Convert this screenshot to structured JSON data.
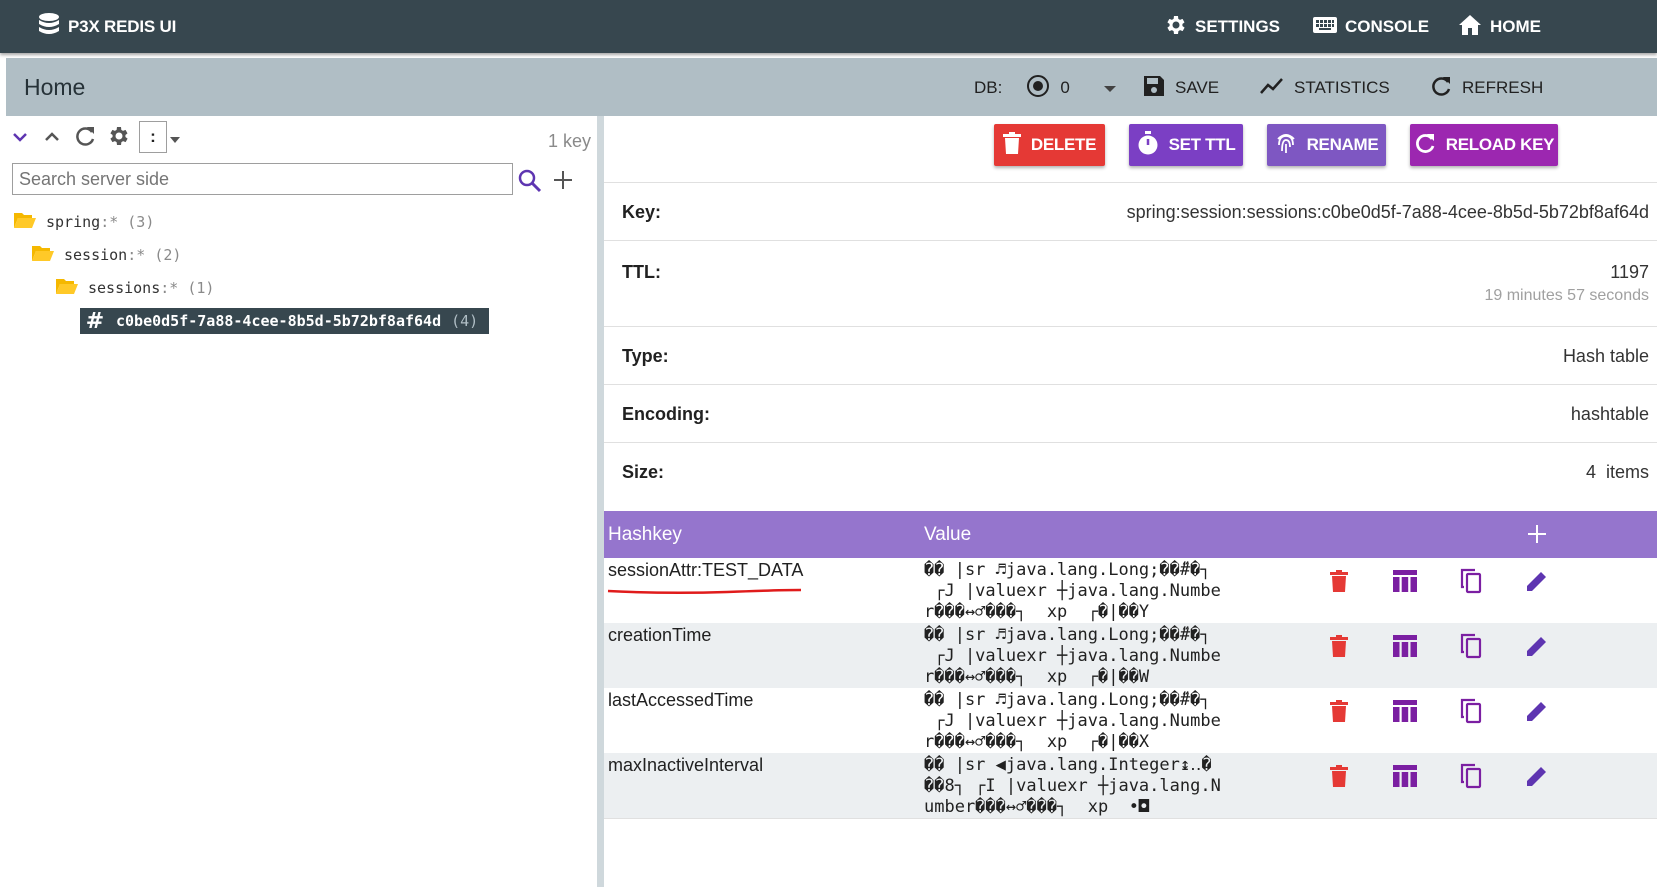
{
  "app": {
    "title": "P3X REDIS UI"
  },
  "nav": {
    "settings": "SETTINGS",
    "console": "CONSOLE",
    "home": "HOME"
  },
  "toolbar": {
    "page_title": "Home",
    "db_label": "DB:",
    "db_value": "0",
    "save": "SAVE",
    "statistics": "STATISTICS",
    "refresh": "REFRESH"
  },
  "tree": {
    "separator": ":",
    "key_count": "1 key",
    "search_placeholder": "Search server side",
    "nodes": [
      {
        "name": "spring",
        "suffix": ":*",
        "count": "(3)"
      },
      {
        "name": "session",
        "suffix": ":*",
        "count": "(2)"
      },
      {
        "name": "sessions",
        "suffix": ":*",
        "count": "(1)"
      }
    ],
    "selected_key": {
      "name": "c0be0d5f-7a88-4cee-8b5d-5b72bf8af64d",
      "count": "(4)"
    }
  },
  "key_actions": {
    "delete": "DELETE",
    "set_ttl": "SET TTL",
    "rename": "RENAME",
    "reload": "RELOAD KEY"
  },
  "key_info": {
    "key_label": "Key:",
    "key_value": "spring:session:sessions:c0be0d5f-7a88-4cee-8b5d-5b72bf8af64d",
    "ttl_label": "TTL:",
    "ttl_value": "1197",
    "ttl_human": "19 minutes 57 seconds",
    "type_label": "Type:",
    "type_value": "Hash table",
    "encoding_label": "Encoding:",
    "encoding_value": "hashtable",
    "size_label": "Size:",
    "size_value": "4  items"
  },
  "hash_table": {
    "col_hashkey": "Hashkey",
    "col_value": "Value",
    "rows": [
      {
        "key": "sessionAttr:TEST_DATA",
        "value": "�� |sr ♬java.lang.Long;��̋#�┐\n ┌J |valuexr ┼java.lang.Numbe\nr���↔♂���┐  xp  ┌�|��Y"
      },
      {
        "key": "creationTime",
        "value": "�� |sr ♬java.lang.Long;��̋#�┐\n ┌J |valuexr ┼java.lang.Numbe\nr���↔♂���┐  xp  ┌�|��W"
      },
      {
        "key": "lastAccessedTime",
        "value": "�� |sr ♬java.lang.Long;��̋#�┐\n ┌J |valuexr ┼java.lang.Numbe\nr���↔♂���┐  xp  ┌�|��X"
      },
      {
        "key": "maxInactiveInterval",
        "value": "�� |sr ◀java.lang.Integer↨‥�\n��8┐ ┌I |valuexr ┼java.lang.N\number���↔♂���┐  xp  •◘"
      }
    ]
  },
  "colors": {
    "appbar": "#37474f",
    "toolbar": "#b0bec5",
    "delete": "#e53935",
    "set_ttl": "#7b3fc4",
    "rename": "#7e57c2",
    "reload": "#9c27b0",
    "hash_header": "#9575cd",
    "accent": "#5e35b1",
    "annotation": "#e01b1b"
  }
}
